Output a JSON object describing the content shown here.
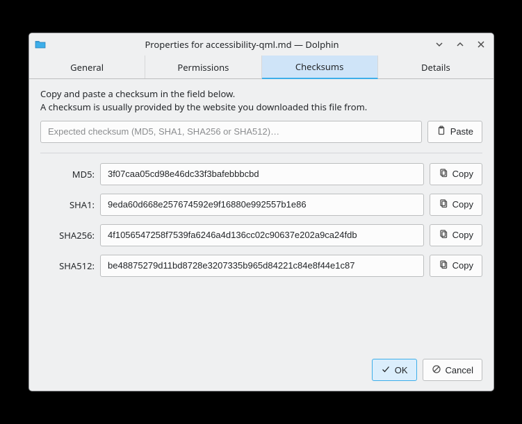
{
  "window": {
    "title": "Properties for accessibility-qml.md — Dolphin"
  },
  "tabs": {
    "general": "General",
    "permissions": "Permissions",
    "checksums": "Checksums",
    "details": "Details"
  },
  "instructions": {
    "line1": "Copy and paste a checksum in the field below.",
    "line2": "A checksum is usually provided by the website you downloaded this file from."
  },
  "expected": {
    "placeholder": "Expected checksum (MD5, SHA1, SHA256 or SHA512)…"
  },
  "buttons": {
    "paste": "Paste",
    "copy": "Copy",
    "ok": "OK",
    "cancel": "Cancel"
  },
  "hashes": {
    "md5": {
      "label": "MD5:",
      "value": "3f07caa05cd98e46dc33f3bafebbbcbd"
    },
    "sha1": {
      "label": "SHA1:",
      "value": "9eda60d668e257674592e9f16880e992557b1e86"
    },
    "sha256": {
      "label": "SHA256:",
      "value": "4f1056547258f7539fa6246a4d136cc02c90637e202a9ca24fdb"
    },
    "sha512": {
      "label": "SHA512:",
      "value": "be48875279d11bd8728e3207335b965d84221c84e8f44e1c87"
    }
  }
}
